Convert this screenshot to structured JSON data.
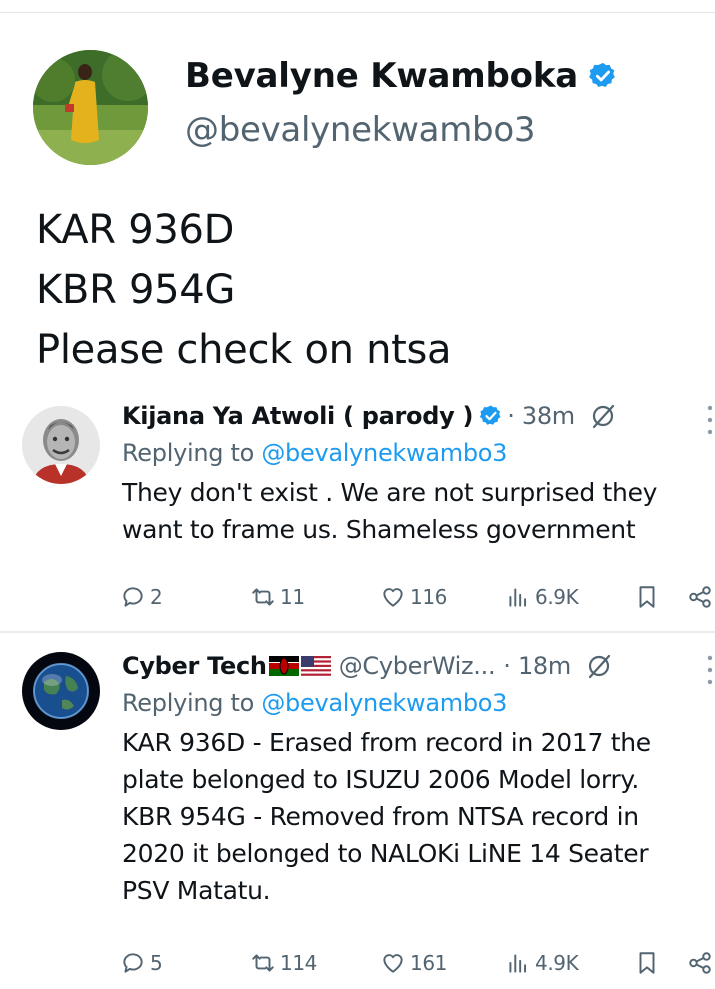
{
  "main_tweet": {
    "author_name": "Bevalyne Kwamboka",
    "author_handle": "@bevalynekwambo3",
    "lines": [
      "KAR 936D",
      "KBR 954G",
      "Please check on ntsa"
    ]
  },
  "replies": [
    {
      "author_name": "Kijana Ya Atwoli ( parody )",
      "author_handle": "",
      "time": "· 38m",
      "replying_prefix": "Replying to",
      "replying_to": "@bevalynekwambo3",
      "lines": [
        "They don't exist . We are not surprised they",
        "want to frame us. Shameless government"
      ],
      "stats": {
        "replies": "2",
        "reposts": "11",
        "likes": "116",
        "views": "6.9K"
      }
    },
    {
      "author_name": "Cyber Tech",
      "author_handle": "@CyberWiz...",
      "time": "· 18m",
      "replying_prefix": "Replying to",
      "replying_to": "@bevalynekwambo3",
      "lines": [
        "KAR 936D - Erased from record in 2017 the",
        "plate belonged to ISUZU 2006 Model lorry.",
        "KBR 954G - Removed from NTSA record in",
        "2020 it belonged to NALOKi LiNE 14 Seater",
        "PSV Matatu."
      ],
      "stats": {
        "replies": "5",
        "reposts": "114",
        "likes": "161",
        "views": "4.9K"
      }
    }
  ],
  "icons": {
    "verified": "verified-badge-icon",
    "grok": "grok-icon",
    "more": "more-vertical-icon",
    "reply": "reply-icon",
    "repost": "repost-icon",
    "like": "heart-icon",
    "views": "views-icon",
    "bookmark": "bookmark-icon",
    "share": "share-icon"
  },
  "colors": {
    "text": "#0f1419",
    "secondary": "#536471",
    "link": "#1d9bf0",
    "divider": "#e9ecee"
  }
}
